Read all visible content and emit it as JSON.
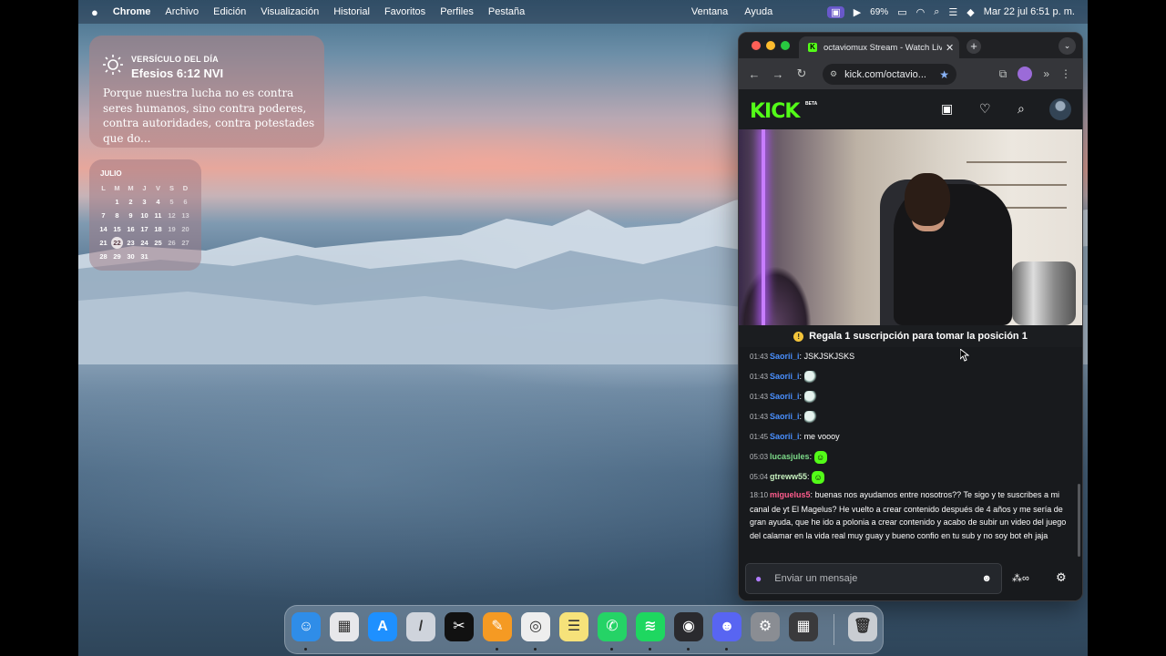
{
  "menubar": {
    "apple": "",
    "app_name": "Chrome",
    "menus": [
      "Archivo",
      "Edición",
      "Visualización",
      "Historial",
      "Favoritos",
      "Perfiles",
      "Pestaña"
    ],
    "menus_right": [
      "Ventana",
      "Ayuda"
    ],
    "battery": "69%",
    "datetime": "Mar 22 jul  6:51 p. m."
  },
  "verse_widget": {
    "heading": "VERSÍCULO DEL DÍA",
    "reference": "Efesios 6:12 NVI",
    "text": "Porque nuestra lucha no es contra seres humanos, sino contra poderes, contra autoridades, contra potestades que do..."
  },
  "calendar_widget": {
    "month": "JULIO",
    "weekdays": [
      "L",
      "M",
      "M",
      "J",
      "V",
      "S",
      "D"
    ],
    "weeks": [
      [
        "",
        "1",
        "2",
        "3",
        "4",
        "5",
        "6"
      ],
      [
        "7",
        "8",
        "9",
        "10",
        "11",
        "12",
        "13"
      ],
      [
        "14",
        "15",
        "16",
        "17",
        "18",
        "19",
        "20"
      ],
      [
        "21",
        "22",
        "23",
        "24",
        "25",
        "26",
        "27"
      ],
      [
        "28",
        "29",
        "30",
        "31",
        "",
        "",
        ""
      ]
    ],
    "today": "22"
  },
  "browser": {
    "tab_title": "octaviomux Stream - Watch Live",
    "tab_favicon": "K",
    "url": "kick.com/octavio...",
    "new_tab": "+",
    "tab_menu": "⌄"
  },
  "kick": {
    "logo": "KICK",
    "beta": "BETA",
    "pinned": "Regala 1 suscripción para tomar la posición 1",
    "chat": [
      {
        "ts": "01:43",
        "user": "Saorii_i",
        "color": "#4a90ff",
        "text": "JSKJSKJSKS",
        "emote": ""
      },
      {
        "ts": "01:43",
        "user": "Saorii_i",
        "color": "#4a90ff",
        "text": "",
        "emote": "ghost"
      },
      {
        "ts": "01:43",
        "user": "Saorii_i",
        "color": "#4a90ff",
        "text": "",
        "emote": "ghost"
      },
      {
        "ts": "01:43",
        "user": "Saorii_i",
        "color": "#4a90ff",
        "text": "",
        "emote": "ghost"
      },
      {
        "ts": "01:45",
        "user": "Saorii_i",
        "color": "#4a90ff",
        "text": "me voooy",
        "emote": ""
      },
      {
        "ts": "05:03",
        "user": "lucasjules",
        "color": "#7ddc8a",
        "text": "",
        "emote": "kick"
      },
      {
        "ts": "05:04",
        "user": "gtreww55",
        "color": "#c8f2c0",
        "text": "",
        "emote": "kick"
      },
      {
        "ts": "18:10",
        "user": "miguelus5",
        "color": "#ff5c8d",
        "text": "buenas nos ayudamos entre nosotros?? Te sigo y te suscribes a mi canal de yt El Magelus? He vuelto a crear contenido después de 4 años y me sería de gran ayuda, que he ido a polonia a crear contenido y acabo de subir un video del juego del calamar en la vida real muy guay y bueno confio en tu sub y no soy bot eh jaja",
        "emote": ""
      }
    ],
    "input_placeholder": "Enviar un mensaje"
  },
  "dock": {
    "apps": [
      {
        "name": "finder",
        "glyph": "☺",
        "color": "#2f8de8"
      },
      {
        "name": "launchpad",
        "glyph": "▦",
        "color": "#e7e7ea"
      },
      {
        "name": "app-store",
        "glyph": "A",
        "color": "#1e90ff"
      },
      {
        "name": "books-clip",
        "glyph": "/",
        "color": "#cfd4dc"
      },
      {
        "name": "capcut",
        "glyph": "✂",
        "color": "#111111"
      },
      {
        "name": "pages",
        "glyph": "✎",
        "color": "#f59a23"
      },
      {
        "name": "chrome",
        "glyph": "◎",
        "color": "#eeeeee"
      },
      {
        "name": "notes",
        "glyph": "☰",
        "color": "#f6e27a"
      },
      {
        "name": "whatsapp",
        "glyph": "✆",
        "color": "#25d366"
      },
      {
        "name": "spotify",
        "glyph": "≋",
        "color": "#1ed760"
      },
      {
        "name": "obs",
        "glyph": "◉",
        "color": "#2a2a2e"
      },
      {
        "name": "discord",
        "glyph": "☻",
        "color": "#5865f2"
      },
      {
        "name": "system-settings",
        "glyph": "⚙",
        "color": "#8a8d93"
      },
      {
        "name": "calculator",
        "glyph": "▦",
        "color": "#3a3a3c"
      },
      {
        "name": "trash",
        "glyph": "🗑",
        "color": "#c9cdd2"
      }
    ]
  }
}
